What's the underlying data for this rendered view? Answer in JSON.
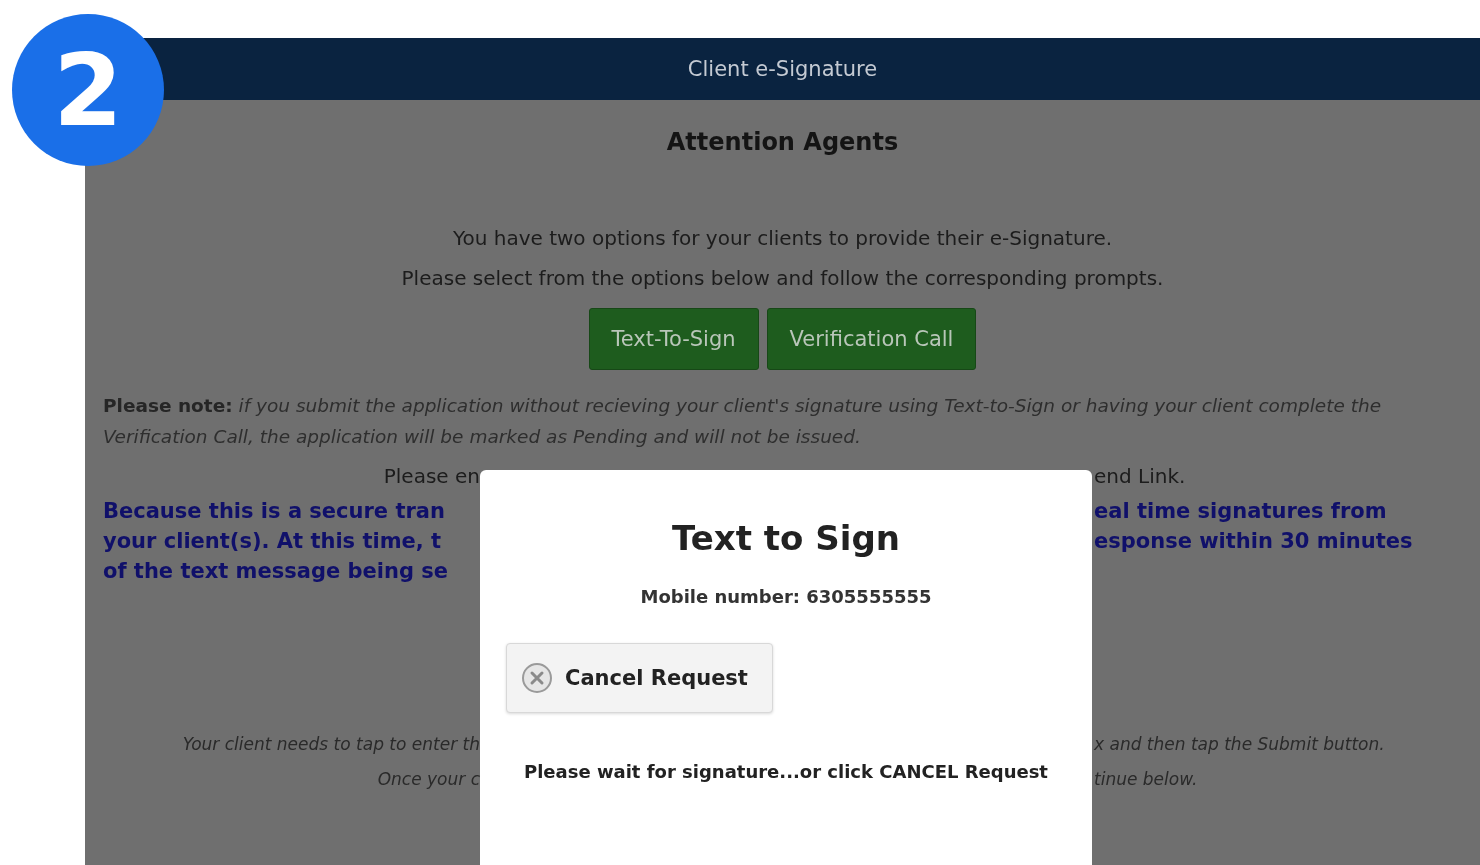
{
  "badge": "2",
  "header": {
    "title": "Client e-Signature"
  },
  "heading": "Attention Agents",
  "intro": [
    "You have two options for your clients to provide their e-Signature.",
    "Please select from the options below and follow the corresponding prompts."
  ],
  "options": [
    "Text-To-Sign",
    "Verification Call"
  ],
  "note": "**Please note:** *if you submit the application without recieving your client's signature using Text-to-Sign or having your client complete the Verification Call, the application will be marked as Pending and will not be issued.*",
  "rows_top": [
    {
      "kind": "plain",
      "left": "Please en",
      "right": "end Link."
    },
    {
      "kind": "bold",
      "left": "Because this is a secure tran",
      "right": "eal time signatures from"
    },
    {
      "kind": "bold",
      "left": "your client(s). At this time, t",
      "right": "esponse within 30 minutes"
    },
    {
      "kind": "bold",
      "left": "of the text message being se"
    }
  ],
  "rows_bottom": [
    {
      "kind": "italic",
      "left": "Your client needs to tap to enter th",
      "right": "x and then tap the Submit button."
    },
    {
      "kind": "italic",
      "left": "Once your c",
      "right": "tinue below."
    }
  ],
  "modal": {
    "title": "Text to Sign",
    "mobile": "Mobile number: 6305555555",
    "cancel_button": "Cancel Request",
    "wait_text": "Please wait for signature...or click CANCEL Request"
  }
}
